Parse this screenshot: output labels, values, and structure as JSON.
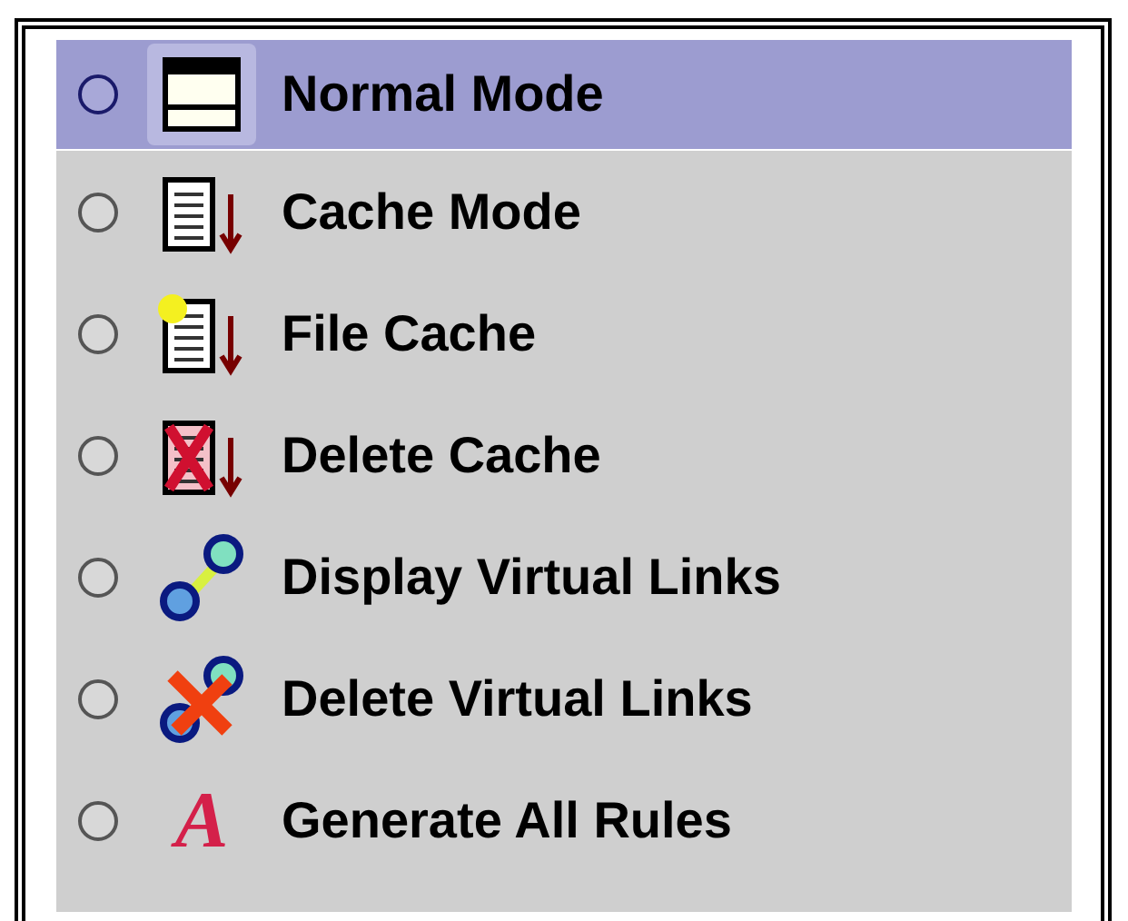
{
  "menu": {
    "items": [
      {
        "label": "Normal Mode",
        "kind": "window",
        "selected": true
      },
      {
        "label": "Cache Mode",
        "kind": "document",
        "selected": false
      },
      {
        "label": "File Cache",
        "kind": "file",
        "selected": false
      },
      {
        "label": "Delete Cache",
        "kind": "delete",
        "selected": false
      },
      {
        "label": "Display Virtual Links",
        "kind": "link",
        "selected": false
      },
      {
        "label": "Delete Virtual Links",
        "kind": "unlink",
        "selected": false
      },
      {
        "label": "Generate All Rules",
        "kind": "letter",
        "icon_char": "A",
        "selected": false
      }
    ]
  }
}
